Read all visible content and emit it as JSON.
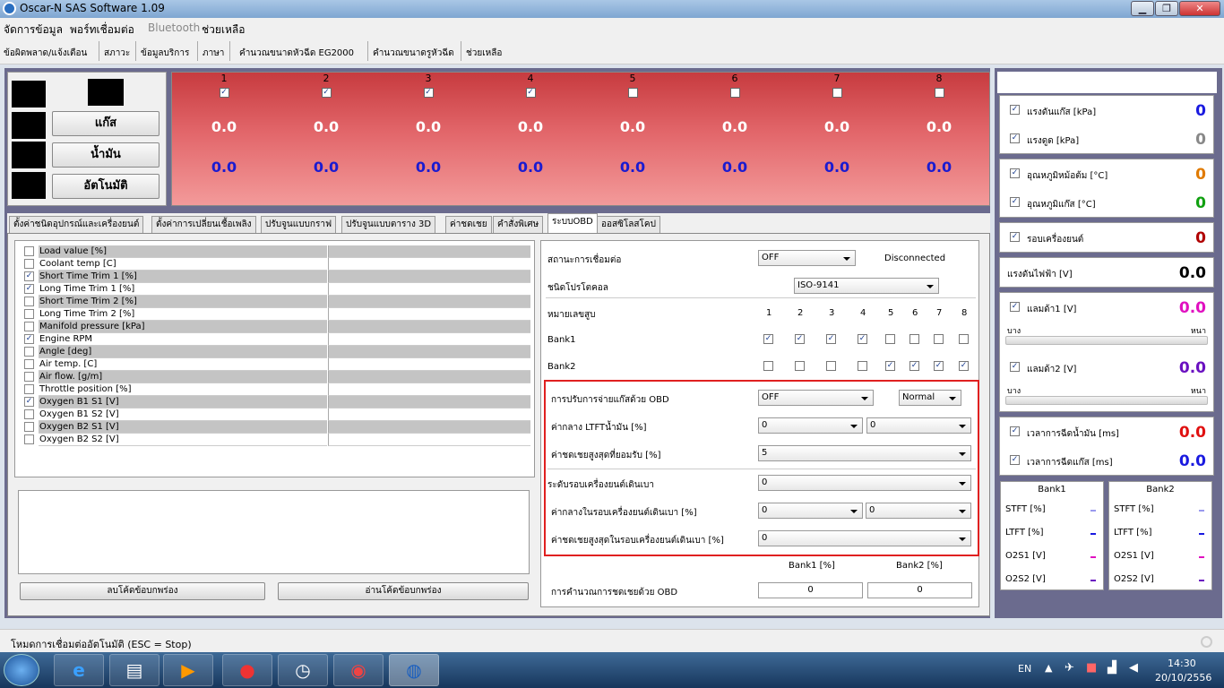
{
  "window": {
    "title": "Oscar-N SAS Software 1.09",
    "buttons": {
      "minimize": "▁",
      "maximize": "❐",
      "close": "✕"
    }
  },
  "menu": {
    "items": [
      "จัดการข้อมูล",
      "พอร์ทเชื่อมต่อ",
      "Bluetooth",
      "ช่วยเหลือ"
    ]
  },
  "toolbar": {
    "items": [
      "ข้อผิดพลาด/แจ้งเตือน",
      "สภาวะ",
      "ข้อมูลบริการ",
      "ภาษา",
      "คำนวณขนาดหัวฉีด EG2000",
      "คำนวณขนาดรูหัวฉีด",
      "ช่วยเหลือ"
    ]
  },
  "left_buttons": {
    "gas": "แก๊ส",
    "oil": "น้ำมัน",
    "auto": "อัตโนมัติ"
  },
  "injectors": [
    {
      "num": "1",
      "checked": true,
      "v1": "0.0",
      "v2": "0.0"
    },
    {
      "num": "2",
      "checked": true,
      "v1": "0.0",
      "v2": "0.0"
    },
    {
      "num": "3",
      "checked": true,
      "v1": "0.0",
      "v2": "0.0"
    },
    {
      "num": "4",
      "checked": true,
      "v1": "0.0",
      "v2": "0.0"
    },
    {
      "num": "5",
      "checked": false,
      "v1": "0.0",
      "v2": "0.0"
    },
    {
      "num": "6",
      "checked": false,
      "v1": "0.0",
      "v2": "0.0"
    },
    {
      "num": "7",
      "checked": false,
      "v1": "0.0",
      "v2": "0.0"
    },
    {
      "num": "8",
      "checked": false,
      "v1": "0.0",
      "v2": "0.0"
    }
  ],
  "tabs": [
    "ตั้งค่าชนิดอุปกรณ์และเครื่องยนต์",
    "ตั้งค่าการเปลี่ยนเชื้อเพลิง",
    "ปรับจูนแบบกราฟ",
    "ปรับจูนแบบตาราง 3D",
    "ค่าชดเชย",
    "คำสั่งพิเศษ",
    "ระบบOBD",
    "ออสซิโลสโคป"
  ],
  "params": [
    {
      "label": "Load value [%]",
      "checked": false
    },
    {
      "label": "Coolant temp [C]",
      "checked": false
    },
    {
      "label": "Short Time Trim 1 [%]",
      "checked": true
    },
    {
      "label": "Long Time Trim 1 [%]",
      "checked": true
    },
    {
      "label": "Short Time Trim 2 [%]",
      "checked": false
    },
    {
      "label": "Long Time Trim 2 [%]",
      "checked": false
    },
    {
      "label": "Manifold pressure [kPa]",
      "checked": false
    },
    {
      "label": "Engine RPM",
      "checked": true
    },
    {
      "label": "Angle [deg]",
      "checked": false
    },
    {
      "label": "Air temp. [C]",
      "checked": false
    },
    {
      "label": "Air flow. [g/m]",
      "checked": false
    },
    {
      "label": "Throttle position [%]",
      "checked": false
    },
    {
      "label": "Oxygen B1 S1 [V]",
      "checked": true
    },
    {
      "label": "Oxygen B1 S2 [V]",
      "checked": false
    },
    {
      "label": "Oxygen B2 S1 [V]",
      "checked": false
    },
    {
      "label": "Oxygen B2 S2 [V]",
      "checked": false
    }
  ],
  "bottom_buttons": {
    "clear": "ลบโค้ดข้อบกพร่อง",
    "read": "อ่านโค้ดข้อบกพร่อง"
  },
  "obd": {
    "conn_label": "สถานะการเชื่อมต่อ",
    "conn_value": "OFF",
    "conn_status": "Disconnected",
    "protocol_label": "ชนิดโปรโตคอล",
    "protocol_value": "ISO-9141",
    "cyl_label": "หมายเลขสูบ",
    "cyl_nums": [
      "1",
      "2",
      "3",
      "4",
      "5",
      "6",
      "7",
      "8"
    ],
    "bank1_label": "Bank1",
    "bank1": [
      true,
      true,
      true,
      true,
      false,
      false,
      false,
      false
    ],
    "bank2_label": "Bank2",
    "bank2": [
      false,
      false,
      false,
      false,
      true,
      true,
      true,
      true
    ],
    "adjust_label": "การปรับการจ่ายแก๊สด้วย OBD",
    "adjust_value": "OFF",
    "mode_value": "Normal",
    "ltft_label": "ค่ากลาง LTFTน้ำมัน [%]",
    "ltft_a": "0",
    "ltft_b": "0",
    "maxcomp_label": "ค่าชดเชยสูงสุดที่ยอมรับ [%]",
    "maxcomp_value": "5",
    "idle_label": "ระดับรอบเครื่องยนต์เดินเบา",
    "idle_value": "0",
    "idle_mid_label": "ค่ากลางในรอบเครื่องยนต์เดินเบา [%]",
    "idle_mid_a": "0",
    "idle_mid_b": "0",
    "idle_max_label": "ค่าชดเชยสูงสุดในรอบเครื่องยนต์เดินเบา [%]",
    "idle_max_value": "0",
    "calc_bank1_hdr": "Bank1 [%]",
    "calc_bank2_hdr": "Bank2 [%]",
    "calc_label": "การคำนวณการชดเชยด้วย OBD",
    "calc_bank1": "0",
    "calc_bank2": "0"
  },
  "right": {
    "gas_pressure": {
      "label": "แรงดันแก๊ส [kPa]",
      "value": "0",
      "color": "#1a1ae0"
    },
    "vacuum": {
      "label": "แรงดูด [kPa]",
      "value": "0",
      "color": "#888888"
    },
    "reducer_temp": {
      "label": "อุณหภูมิหม้อต้ม [°C]",
      "value": "0",
      "color": "#e07a00"
    },
    "gas_temp": {
      "label": "อุณหภูมิแก๊ส [°C]",
      "value": "0",
      "color": "#10a010"
    },
    "rpm": {
      "label": "รอบเครื่องยนต์",
      "value": "0",
      "color": "#b00000"
    },
    "voltage": {
      "label": "แรงดันไฟฟ้า [V]",
      "value": "0.0",
      "color": "#000000"
    },
    "lambda1": {
      "label": "แลมด้า1 [V]",
      "value": "0.0",
      "color": "#e010c0",
      "lean": "บาง",
      "rich": "หนา"
    },
    "lambda2": {
      "label": "แลมด้า2 [V]",
      "value": "0.0",
      "color": "#6a10c0",
      "lean": "บาง",
      "rich": "หนา"
    },
    "oil_inj": {
      "label": "เวลาการฉีดน้ำมัน [ms]",
      "value": "0.0",
      "color": "#e01010"
    },
    "gas_inj": {
      "label": "เวลาการฉีดแก๊ส [ms]",
      "value": "0.0",
      "color": "#1a1ae0"
    },
    "bank1": {
      "title": "Bank1",
      "rows": [
        "STFT [%]",
        "LTFT [%]",
        "O2S1 [V]",
        "O2S2 [V]"
      ]
    },
    "bank2": {
      "title": "Bank2",
      "rows": [
        "STFT [%]",
        "LTFT [%]",
        "O2S1 [V]",
        "O2S2 [V]"
      ]
    }
  },
  "status": {
    "text": "โหมดการเชื่อมต่ออัตโนมัติ (ESC = Stop)"
  },
  "taskbar": {
    "lang": "EN",
    "time": "14:30",
    "date": "20/10/2556"
  }
}
